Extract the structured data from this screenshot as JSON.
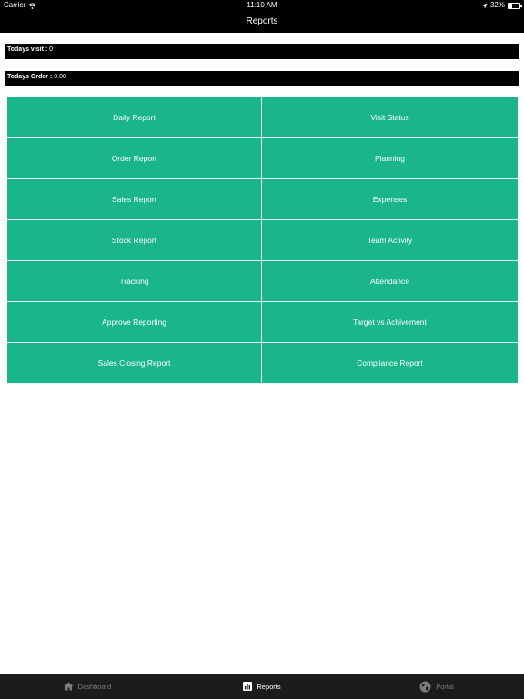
{
  "status_bar": {
    "carrier": "Carrier",
    "time": "11:10 AM",
    "battery_text": "32%",
    "battery_level": 0.32
  },
  "header": {
    "title": "Reports"
  },
  "info": {
    "visit_label": "Todays visit :",
    "visit_value": "0",
    "order_label": "Todays Order :",
    "order_value": "0.00"
  },
  "report_grid": {
    "accent_color": "#1ab58a",
    "items": [
      {
        "label": "Daily Report"
      },
      {
        "label": "Visit Status"
      },
      {
        "label": "Order Report"
      },
      {
        "label": "Planning"
      },
      {
        "label": "Sales Report"
      },
      {
        "label": "Expenses"
      },
      {
        "label": "Stock Report"
      },
      {
        "label": "Team Activity"
      },
      {
        "label": "Tracking"
      },
      {
        "label": "Attendance"
      },
      {
        "label": "Approve Reporting"
      },
      {
        "label": "Target vs Achivement"
      },
      {
        "label": "Sales Closing Report"
      },
      {
        "label": "Compliance Report"
      }
    ]
  },
  "tab_bar": {
    "tabs": [
      {
        "label": "Dashboard",
        "icon": "home-icon",
        "active": false
      },
      {
        "label": "Reports",
        "icon": "reports-icon",
        "active": true
      },
      {
        "label": "Portal",
        "icon": "globe-icon",
        "active": false
      }
    ]
  }
}
